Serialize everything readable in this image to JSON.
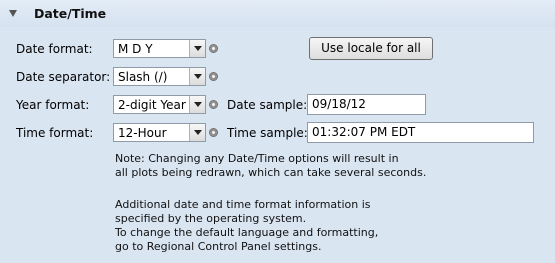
{
  "section": {
    "title": "Date/Time"
  },
  "date_format": {
    "label": "Date format:",
    "value": "M D Y"
  },
  "use_locale_button": {
    "label": "Use locale for all"
  },
  "date_separator": {
    "label": "Date separator:",
    "value": "Slash (/)"
  },
  "year_format": {
    "label": "Year format:",
    "value": "2-digit Year"
  },
  "date_sample": {
    "label": "Date sample:",
    "value": "09/18/12"
  },
  "time_format": {
    "label": "Time format:",
    "value": "12-Hour"
  },
  "time_sample": {
    "label": "Time sample:",
    "value": "01:32:07 PM EDT"
  },
  "notes": {
    "line1": "Note: Changing any Date/Time options will result in",
    "line2": "all plots being redrawn, which can take several seconds.",
    "line3": "Additional date and time format information is",
    "line4": "specified by the operating system.",
    "line5": "To change the default language and formatting,",
    "line6": "go to Regional Control Panel settings."
  }
}
